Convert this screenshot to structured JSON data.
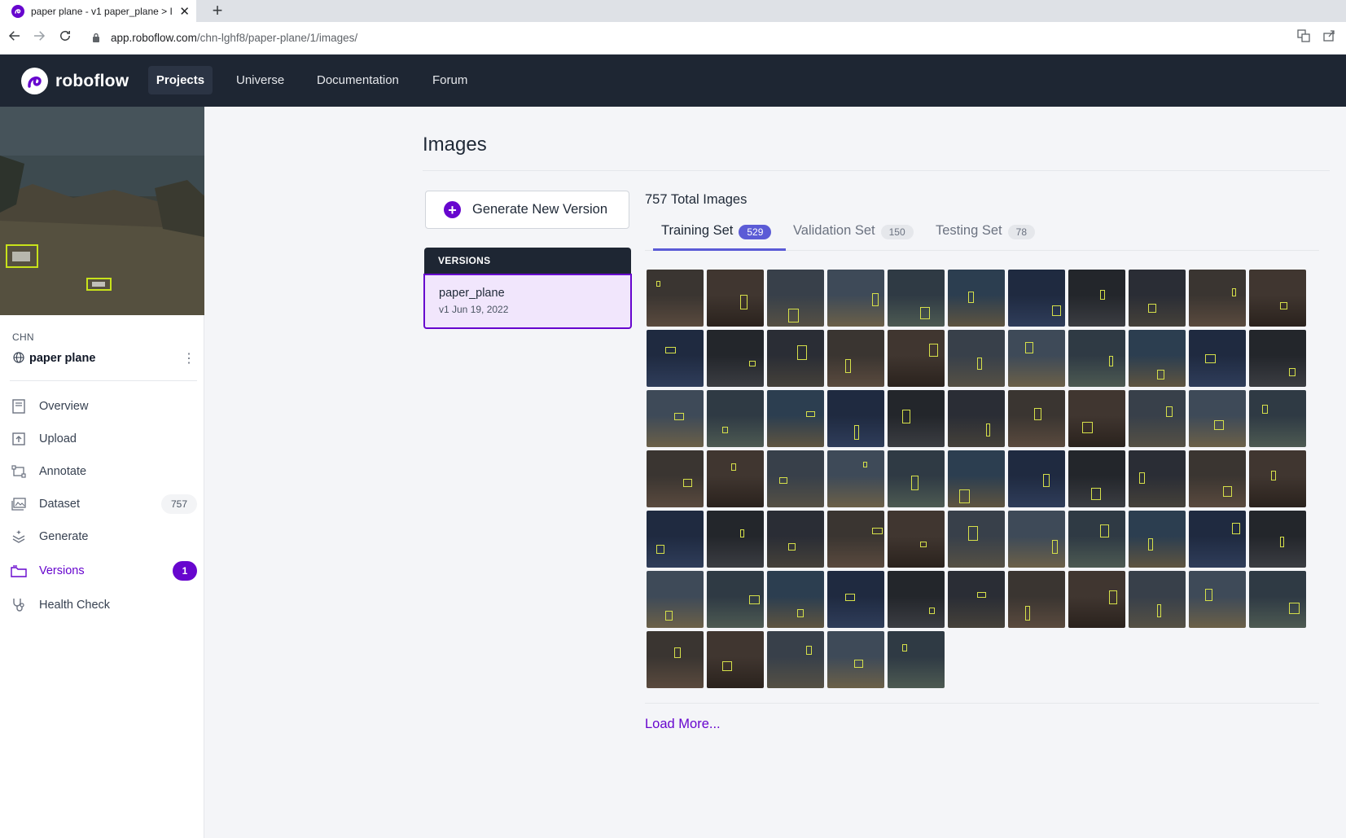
{
  "browser": {
    "tab_title": "paper plane - v1 paper_plane > I",
    "url_host": "app.roboflow.com",
    "url_path": "/chn-lghf8/paper-plane/1/images/"
  },
  "nav": {
    "brand": "roboflow",
    "links": [
      "Projects",
      "Universe",
      "Documentation",
      "Forum"
    ],
    "active": "Projects"
  },
  "sidebar": {
    "workspace": "CHN",
    "project_name": "paper plane",
    "items": [
      {
        "label": "Overview",
        "icon": "overview-icon"
      },
      {
        "label": "Upload",
        "icon": "upload-icon"
      },
      {
        "label": "Annotate",
        "icon": "annotate-icon"
      },
      {
        "label": "Dataset",
        "icon": "dataset-icon",
        "badge": "757"
      },
      {
        "label": "Generate",
        "icon": "generate-icon"
      },
      {
        "label": "Versions",
        "icon": "versions-icon",
        "badge": "1",
        "active": true
      },
      {
        "label": "Health Check",
        "icon": "health-check-icon"
      }
    ]
  },
  "main": {
    "title": "Images",
    "generate_button": "Generate New Version",
    "versions_header": "VERSIONS",
    "version": {
      "name": "paper_plane",
      "date": "v1 Jun 19, 2022"
    },
    "total_images": "757 Total Images",
    "sets": [
      {
        "label": "Training Set",
        "count": "529",
        "active": true
      },
      {
        "label": "Validation Set",
        "count": "150"
      },
      {
        "label": "Testing Set",
        "count": "78"
      }
    ],
    "load_more": "Load More..."
  },
  "thumbnail_count": 71,
  "colors": {
    "accent": "#6706ce",
    "nav_bg": "#1e2633",
    "tab_active": "#5b5bd6",
    "annotation_box": "#d6e04a"
  }
}
